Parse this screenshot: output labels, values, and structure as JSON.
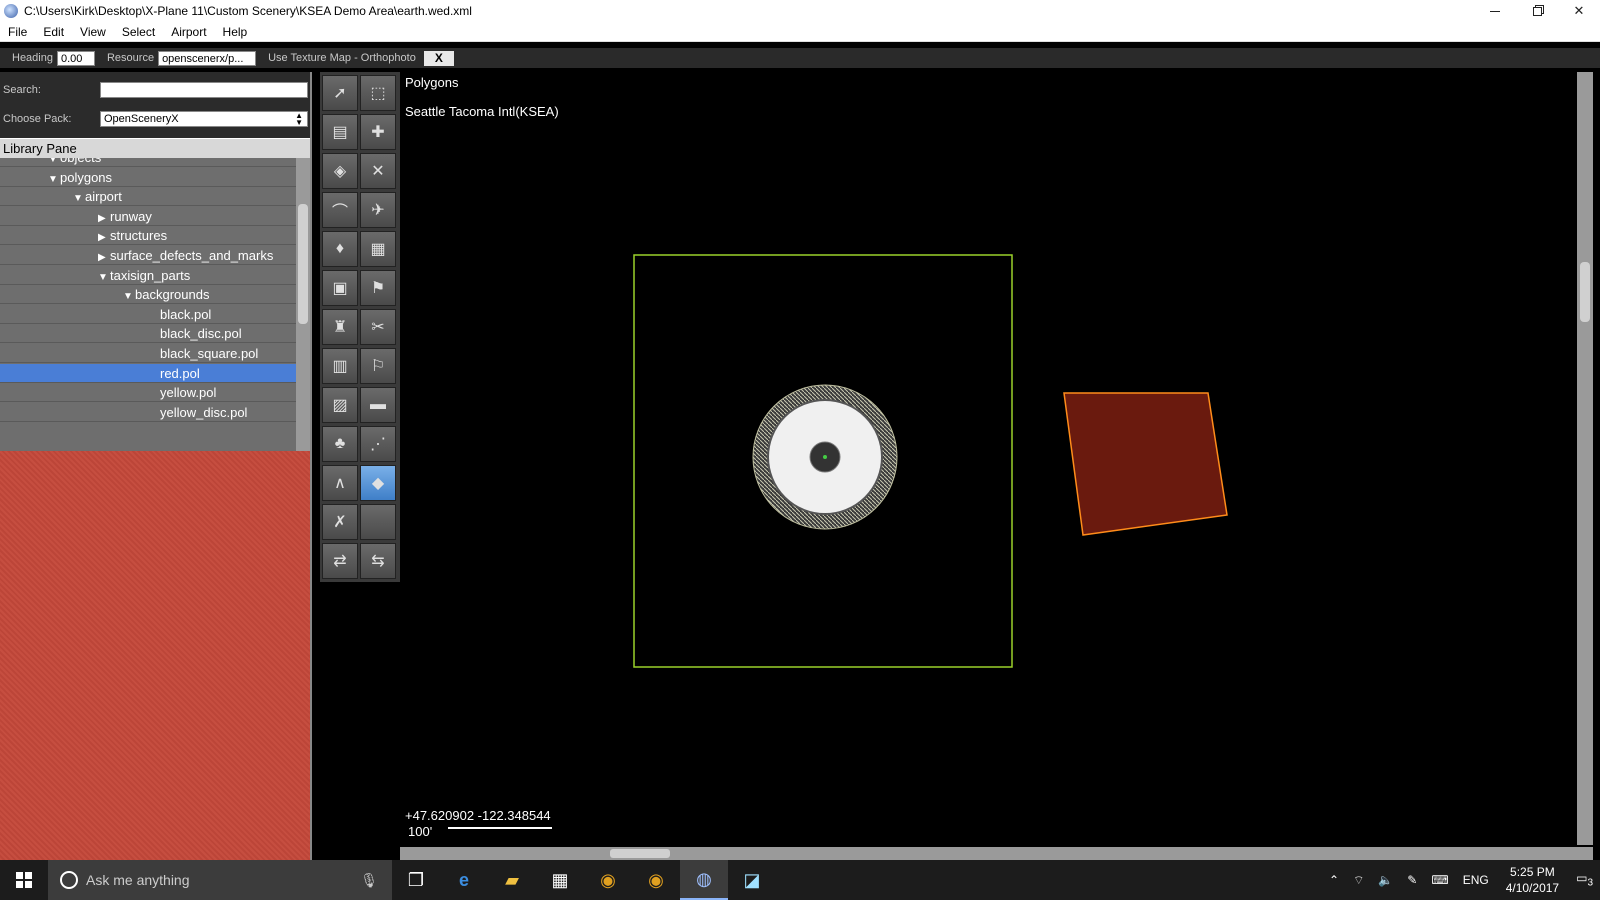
{
  "window": {
    "title": "C:\\Users\\Kirk\\Desktop\\X-Plane 11\\Custom Scenery\\KSEA Demo Area\\earth.wed.xml",
    "min_glyph": "",
    "max_glyph": "",
    "close_glyph": "✕"
  },
  "menu": [
    "File",
    "Edit",
    "View",
    "Select",
    "Airport",
    "Help"
  ],
  "props": {
    "heading_label": "Heading",
    "heading_value": "0.00",
    "resource_label": "Resource",
    "resource_value": "openscenerx/p...",
    "texture_label": "Use Texture Map - Orthophoto",
    "texture_close": "X"
  },
  "library": {
    "search_label": "Search:",
    "search_value": "",
    "pack_label": "Choose Pack:",
    "pack_value": "OpenSceneryX",
    "header": "Library Pane",
    "tree": [
      {
        "label": "objects",
        "indent": 2,
        "tri": "▼"
      },
      {
        "label": "polygons",
        "indent": 2,
        "tri": "▼"
      },
      {
        "label": "airport",
        "indent": 3,
        "tri": "▼"
      },
      {
        "label": "runway",
        "indent": 4,
        "tri": "▶"
      },
      {
        "label": "structures",
        "indent": 4,
        "tri": "▶"
      },
      {
        "label": "surface_defects_and_marks",
        "indent": 4,
        "tri": "▶"
      },
      {
        "label": "taxisign_parts",
        "indent": 4,
        "tri": "▼"
      },
      {
        "label": "backgrounds",
        "indent": 5,
        "tri": "▼"
      },
      {
        "label": "black.pol",
        "indent": 6,
        "tri": ""
      },
      {
        "label": "black_disc.pol",
        "indent": 6,
        "tri": ""
      },
      {
        "label": "black_square.pol",
        "indent": 6,
        "tri": ""
      },
      {
        "label": "red.pol",
        "indent": 6,
        "tri": "",
        "selected": true
      },
      {
        "label": "yellow.pol",
        "indent": 6,
        "tri": ""
      },
      {
        "label": "yellow_disc.pol",
        "indent": 6,
        "tri": ""
      }
    ]
  },
  "tools": [
    {
      "name": "vertex-tool",
      "glyph": "➚"
    },
    {
      "name": "marquee-tool",
      "glyph": "⬚"
    },
    {
      "name": "runway-tool",
      "glyph": "▤"
    },
    {
      "name": "helipad-tool",
      "glyph": "✚"
    },
    {
      "name": "taxiway-tool",
      "glyph": "◈"
    },
    {
      "name": "taxilines-tool",
      "glyph": "✕"
    },
    {
      "name": "boundary-tool",
      "glyph": "⌒"
    },
    {
      "name": "ramp-start-tool",
      "glyph": "✈"
    },
    {
      "name": "light-tool",
      "glyph": "♦"
    },
    {
      "name": "sign-tool",
      "glyph": "▦"
    },
    {
      "name": "object-tool",
      "glyph": "▣"
    },
    {
      "name": "windsock-tool",
      "glyph": "⚑"
    },
    {
      "name": "tower-tool",
      "glyph": "♜"
    },
    {
      "name": "truck-tool",
      "glyph": "✂"
    },
    {
      "name": "facade-tool",
      "glyph": "▥"
    },
    {
      "name": "atc-tool",
      "glyph": "⚐"
    },
    {
      "name": "forest-tool",
      "glyph": "▨"
    },
    {
      "name": "string-tool",
      "glyph": "▬"
    },
    {
      "name": "tree-tool",
      "glyph": "♣"
    },
    {
      "name": "line-tool",
      "glyph": "⋰"
    },
    {
      "name": "polygon-tool",
      "glyph": "∧"
    },
    {
      "name": "draped-polygon-tool",
      "glyph": "◆",
      "active": true
    },
    {
      "name": "exclusion-tool",
      "glyph": "✗"
    },
    {
      "name": "blank-tool",
      "glyph": ""
    },
    {
      "name": "route-tool",
      "glyph": "⇄"
    },
    {
      "name": "route-edge-tool",
      "glyph": "⇆"
    }
  ],
  "map": {
    "tool_name": "Polygons",
    "airport_name": "Seattle Tacoma Intl(KSEA)",
    "coords": "+47.620902 -122.348544",
    "scale": "100'",
    "colors": {
      "boundary": "#9bd12a",
      "polygon_fill": "#6a1a0e",
      "polygon_stroke": "#ff8c1a"
    }
  },
  "taskbar": {
    "search_placeholder": "Ask me anything",
    "tray_lang": "ENG",
    "time": "5:25 PM",
    "date": "4/10/2017",
    "notif_count": "3"
  }
}
